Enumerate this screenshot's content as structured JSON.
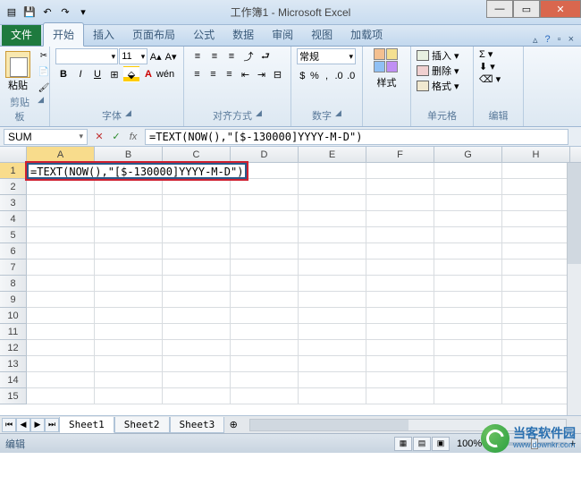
{
  "title": "工作簿1 - Microsoft Excel",
  "qat": {
    "save": "💾",
    "undo": "↶",
    "redo": "↷"
  },
  "tabs": {
    "file": "文件",
    "items": [
      "开始",
      "插入",
      "页面布局",
      "公式",
      "数据",
      "审阅",
      "视图",
      "加载项"
    ],
    "active_index": 0
  },
  "ribbon": {
    "clipboard": {
      "paste": "粘贴",
      "label": "剪贴板"
    },
    "font": {
      "name": "",
      "size": "11",
      "label": "字体"
    },
    "align": {
      "label": "对齐方式"
    },
    "number": {
      "format": "常规",
      "label": "数字"
    },
    "styles": {
      "btn": "样式"
    },
    "cells": {
      "insert": "插入",
      "delete": "删除",
      "format": "格式",
      "label": "单元格"
    },
    "edit": {
      "label": "编辑"
    }
  },
  "formula_bar": {
    "name_box": "SUM",
    "formula": "=TEXT(NOW(),\"[$-130000]YYYY-M-D\")"
  },
  "grid": {
    "columns": [
      "A",
      "B",
      "C",
      "D",
      "E",
      "F",
      "G",
      "H"
    ],
    "rows": [
      1,
      2,
      3,
      4,
      5,
      6,
      7,
      8,
      9,
      10,
      11,
      12,
      13,
      14,
      15
    ],
    "active_cell_value": "=TEXT(NOW(),\"[$-130000]YYYY-M-D\")"
  },
  "sheets": {
    "tabs": [
      "Sheet1",
      "Sheet2",
      "Sheet3"
    ],
    "active_index": 0
  },
  "status": {
    "mode": "编辑",
    "zoom": "100%"
  },
  "watermark": {
    "cn": "当客软件园",
    "en": "www.downkr.com"
  }
}
